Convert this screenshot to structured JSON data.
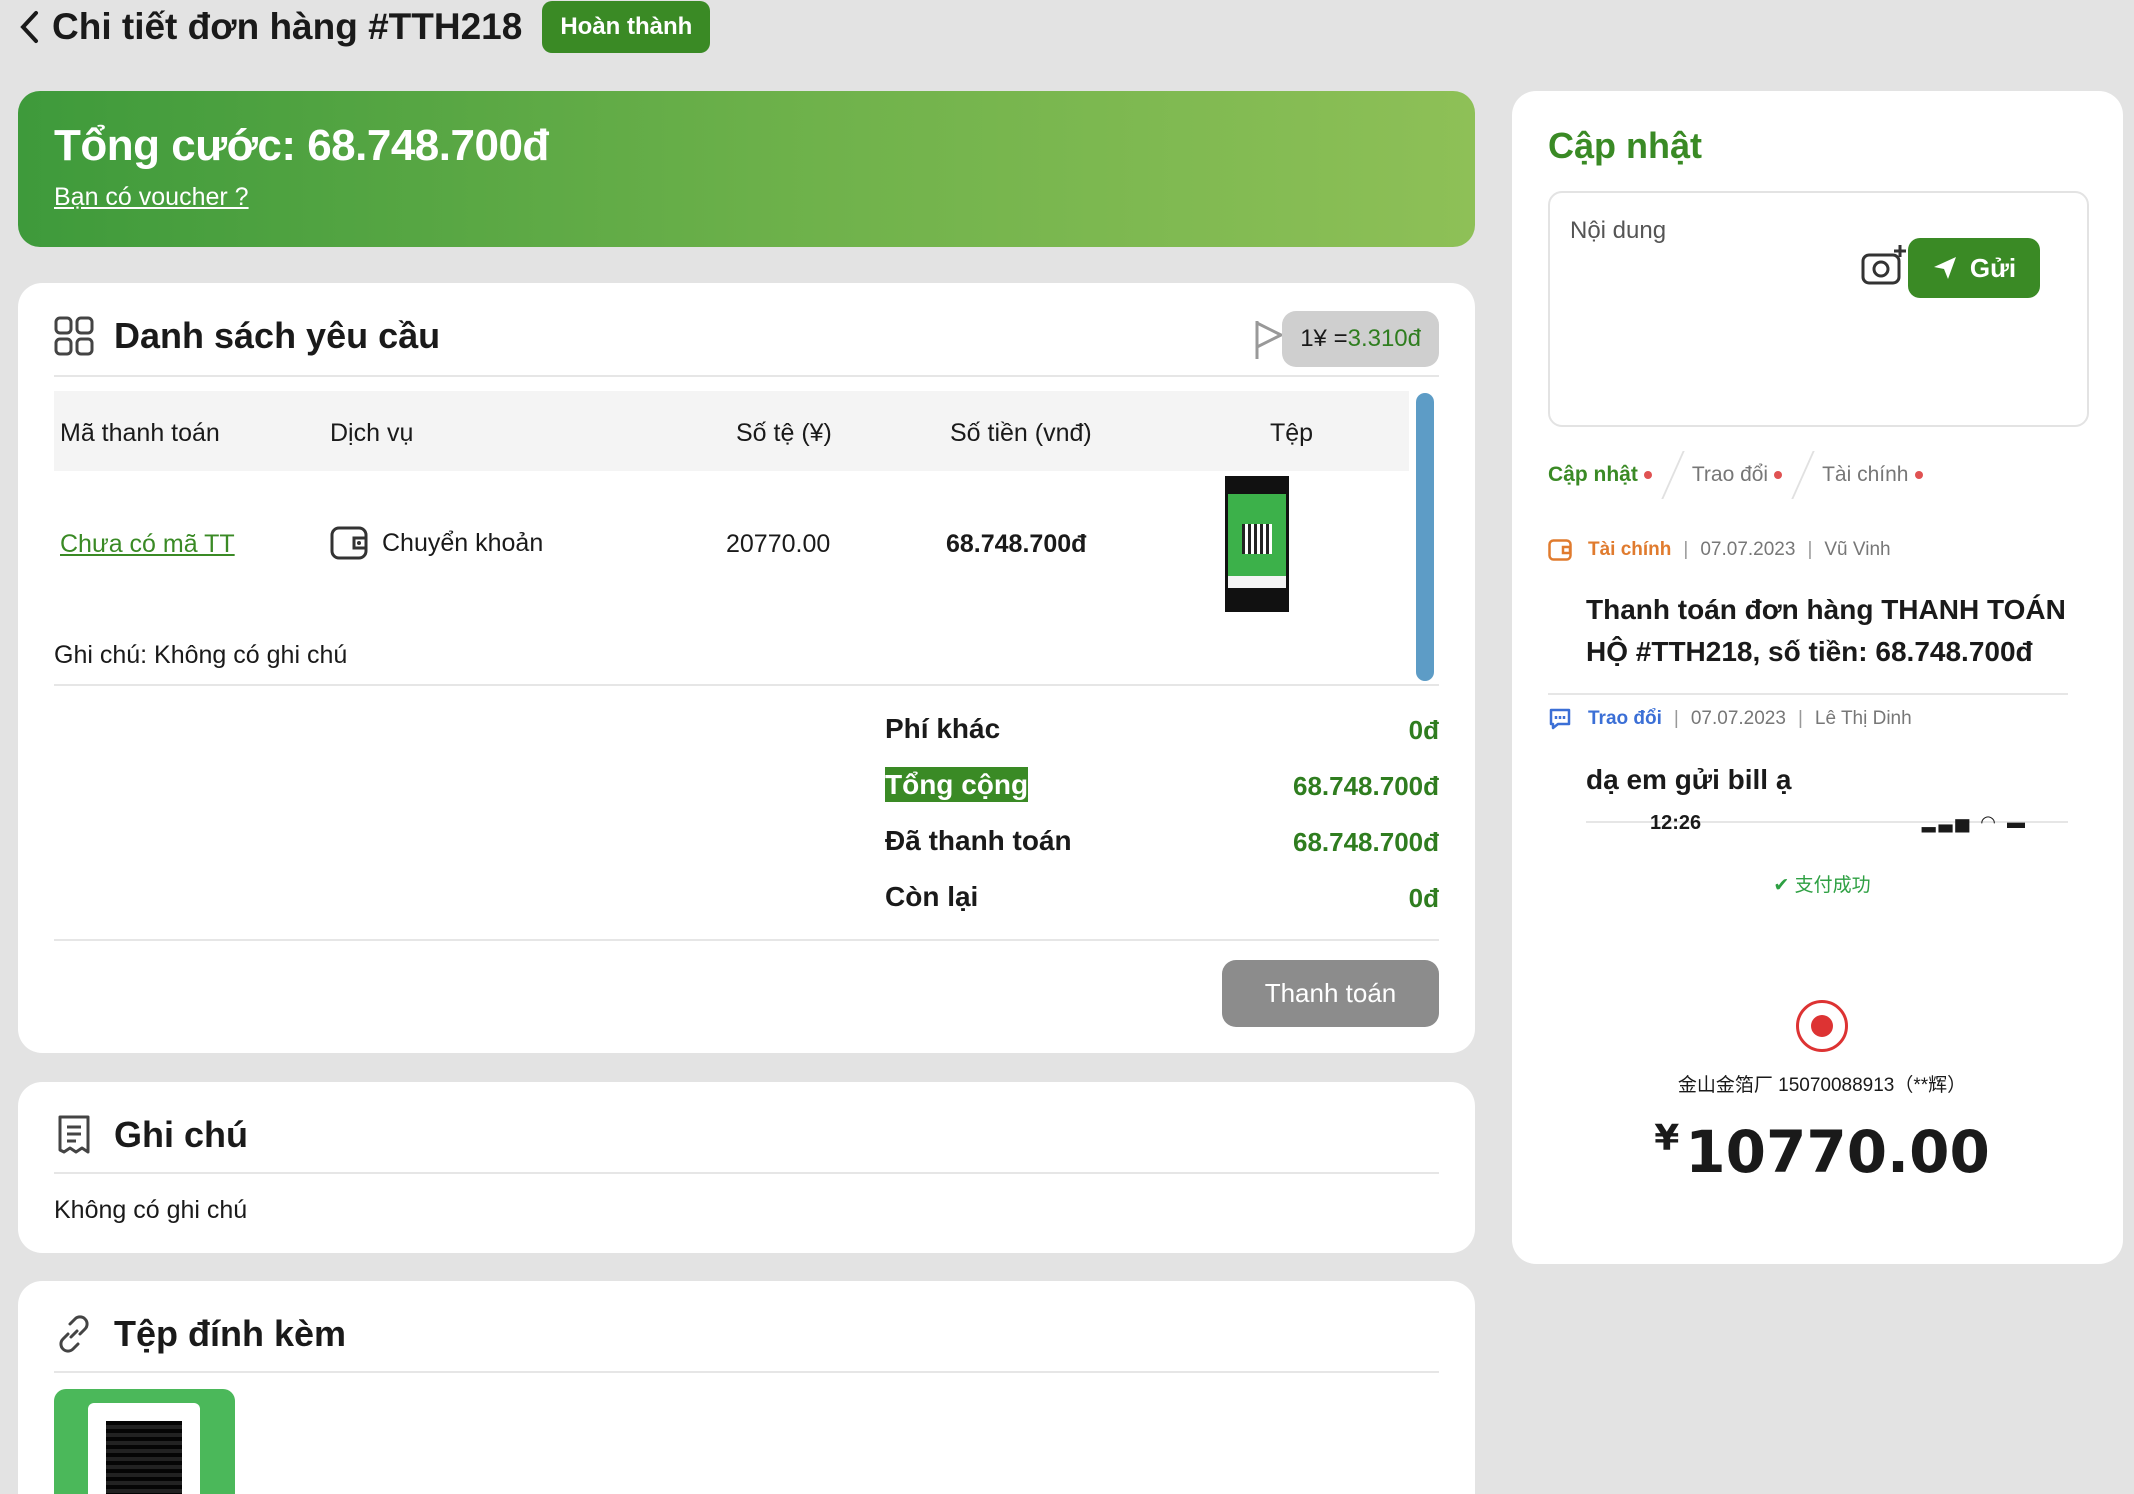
{
  "header": {
    "title": "Chi tiết đơn hàng #TTH218",
    "status": "Hoàn thành"
  },
  "banner": {
    "total": "Tổng cước: 68.748.700đ",
    "voucher": "Bạn có voucher ?"
  },
  "requests": {
    "title": "Danh sách yêu cầu",
    "rate_prefix": "1¥ =",
    "rate_value": "3.310đ",
    "columns": [
      "Mã thanh toán",
      "Dịch vụ",
      "Số tệ (¥)",
      "Số tiền (vnđ)",
      "Tệp"
    ],
    "row": {
      "code": "Chưa có mã TT",
      "service": "Chuyển khoản",
      "yuan": "20770.00",
      "amount": "68.748.700đ"
    },
    "note": "Ghi chú: Không có ghi chú",
    "summary": [
      {
        "label": "Phí khác",
        "value": "0đ"
      },
      {
        "label": "Tổng cộng",
        "value": "68.748.700đ"
      },
      {
        "label": "Đã thanh toán",
        "value": "68.748.700đ"
      },
      {
        "label": "Còn lại",
        "value": "0đ"
      }
    ],
    "pay_button": "Thanh toán"
  },
  "notes": {
    "title": "Ghi chú",
    "text": "Không có ghi chú"
  },
  "attachments": {
    "title": "Tệp đính kèm"
  },
  "updates": {
    "title": "Cập nhật",
    "input_placeholder": "Nội dung",
    "send": "Gửi",
    "tabs": [
      "Cập nhật",
      "Trao đổi",
      "Tài chính"
    ],
    "feed": [
      {
        "category": "Tài chính",
        "date": "07.07.2023",
        "author": "Vũ Vinh",
        "text": "Thanh toán đơn hàng THANH TOÁN HỘ #TTH218, số tiền: 68.748.700đ",
        "color": "#e07b2e"
      },
      {
        "category": "Trao đổi",
        "date": "07.07.2023",
        "author": "Lê Thị Dinh",
        "text": "dạ em gửi bill ạ",
        "color": "#3b6fd6"
      }
    ],
    "receipt": {
      "time": "12:26",
      "success": "支付成功",
      "merchant": "金山金箔厂 15070088913（**辉）",
      "currency": "¥",
      "amount": "10770.00"
    }
  }
}
